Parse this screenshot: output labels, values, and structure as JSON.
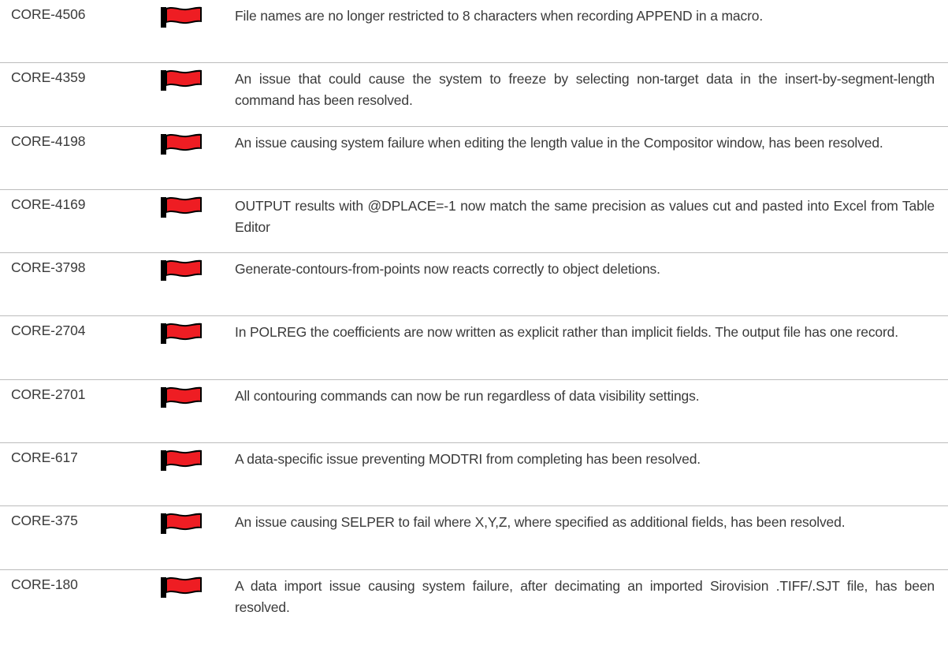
{
  "issues": [
    {
      "id": "CORE-4506",
      "icon": "red-flag-icon",
      "description": "File names are no longer restricted to 8 characters when recording APPEND in a macro."
    },
    {
      "id": "CORE-4359",
      "icon": "red-flag-icon",
      "description": "An issue that could cause the system to freeze by selecting non-target data in the insert-by-segment-length command has been resolved."
    },
    {
      "id": "CORE-4198",
      "icon": "red-flag-icon",
      "description": "An issue causing system failure when editing the length value in the Compositor window, has been resolved."
    },
    {
      "id": "CORE-4169",
      "icon": "red-flag-icon",
      "description": "OUTPUT results with @DPLACE=-1 now match the same precision as values cut and pasted into Excel from Table Editor"
    },
    {
      "id": "CORE-3798",
      "icon": "red-flag-icon",
      "description": "Generate-contours-from-points now reacts correctly to object deletions."
    },
    {
      "id": "CORE-2704",
      "icon": "red-flag-icon",
      "description": "In POLREG the coefficients are now written as explicit rather than implicit fields. The output file has one record."
    },
    {
      "id": "CORE-2701",
      "icon": "red-flag-icon",
      "description": "All contouring commands can now be run regardless of data visibility settings."
    },
    {
      "id": "CORE-617",
      "icon": "red-flag-icon",
      "description": "A data-specific issue preventing MODTRI from completing has been resolved."
    },
    {
      "id": "CORE-375",
      "icon": "red-flag-icon",
      "description": "An issue causing SELPER to fail where X,Y,Z, where specified as additional fields, has been resolved."
    },
    {
      "id": "CORE-180",
      "icon": "red-flag-icon",
      "description": "A data import issue causing system failure, after decimating an imported Sirovision .TIFF/.SJT file, has been resolved."
    }
  ],
  "colors": {
    "flag_red": "#ee1d23",
    "flag_outline": "#000000",
    "text": "#3a3a3a",
    "divider": "#bcbcbc"
  }
}
